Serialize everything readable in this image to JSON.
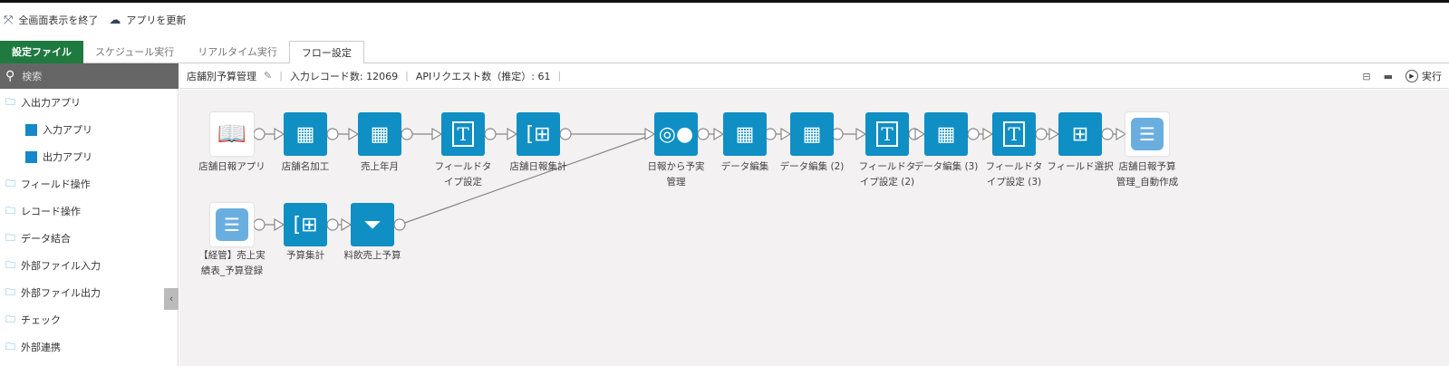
{
  "toolbar": {
    "exit_fullscreen": "全画面表示を終了",
    "update_app": "アプリを更新"
  },
  "tabs": [
    "設定ファイル",
    "スケジュール実行",
    "リアルタイム実行",
    "フロー設定"
  ],
  "search": {
    "placeholder": "検索"
  },
  "sidebar": {
    "items": [
      "入出力アプリ",
      "入力アプリ",
      "出力アプリ",
      "フィールド操作",
      "レコード操作",
      "データ結合",
      "外部ファイル入力",
      "外部ファイル出力",
      "チェック",
      "外部連携"
    ]
  },
  "info": {
    "flow_name": "店舗別予算管理",
    "record_count": "入力レコード数: 12069",
    "api_count": "APIリクエスト数（推定）: 61",
    "run": "実行"
  },
  "nodes": {
    "n1": "店舗日報アプリ",
    "n2": "店舗名加工",
    "n3": "売上年月",
    "n4": "フィールドタイプ設定",
    "n5": "店舗日報集計",
    "n6": "日報から予実管理",
    "n7": "データ編集",
    "n8": "データ編集 (2)",
    "n9": "フィールドタイプ設定 (2)",
    "n10": "データ編集 (3)",
    "n11": "フィールドタイプ設定 (3)",
    "n12": "フィールド選択",
    "n13": "店舗日報予算管理_自動作成",
    "m1": "【経管】売上実績表_予算登録",
    "m2": "予算集計",
    "m3": "料飲売上予算"
  },
  "colors": {
    "accent": "#0f8fc4",
    "green": "#1f7a40"
  }
}
